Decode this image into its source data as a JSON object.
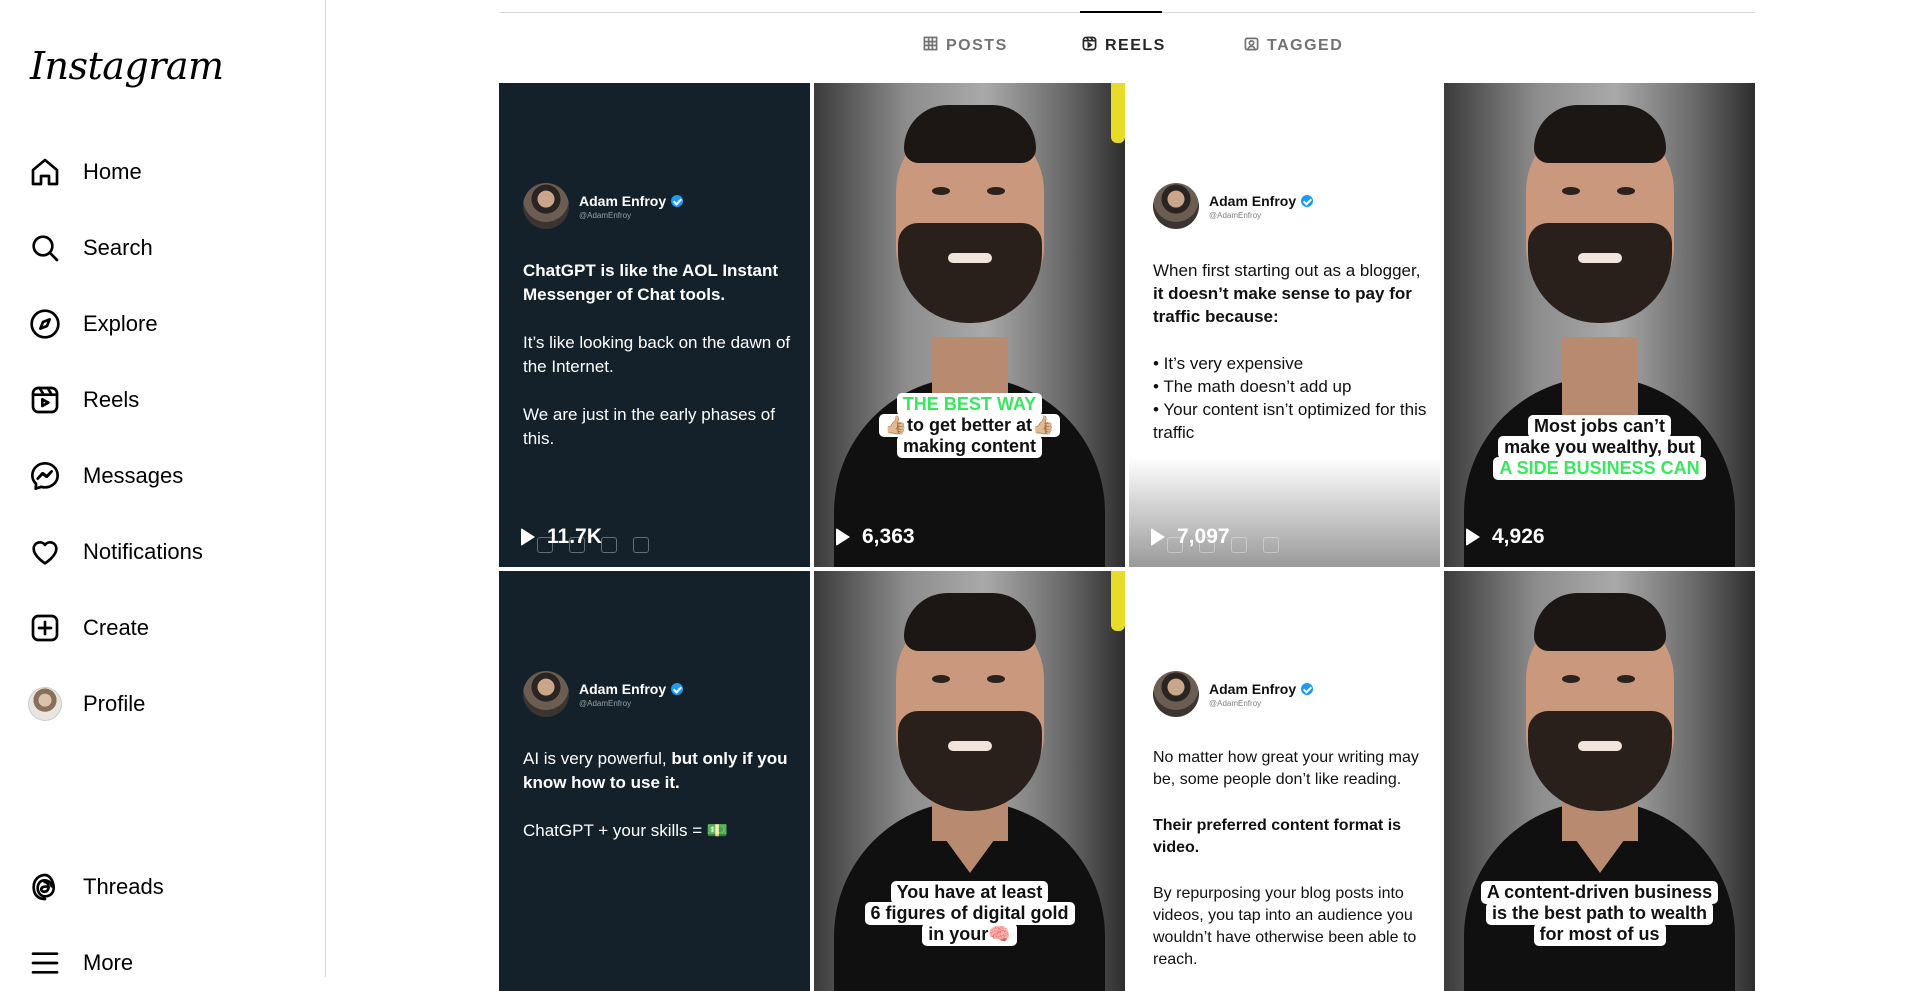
{
  "app": {
    "logo": "Instagram"
  },
  "sidebar": {
    "items": [
      {
        "label": "Home",
        "icon": "home-icon"
      },
      {
        "label": "Search",
        "icon": "search-icon"
      },
      {
        "label": "Explore",
        "icon": "compass-icon"
      },
      {
        "label": "Reels",
        "icon": "reels-icon"
      },
      {
        "label": "Messages",
        "icon": "messenger-icon"
      },
      {
        "label": "Notifications",
        "icon": "heart-icon"
      },
      {
        "label": "Create",
        "icon": "plus-square-icon"
      },
      {
        "label": "Profile",
        "icon": "avatar"
      }
    ],
    "bottom": [
      {
        "label": "Threads",
        "icon": "threads-icon"
      },
      {
        "label": "More",
        "icon": "hamburger-icon"
      }
    ]
  },
  "profile_tabs": [
    {
      "label": "POSTS",
      "icon": "grid-icon",
      "active": false
    },
    {
      "label": "REELS",
      "icon": "reels-icon",
      "active": true
    },
    {
      "label": "TAGGED",
      "icon": "tagged-icon",
      "active": false
    }
  ],
  "reels": [
    {
      "kind": "tweet",
      "theme": "dark",
      "author": "Adam Enfroy",
      "handle": "@AdamEnfroy",
      "paragraphs": [
        "<b>ChatGPT is like the AOL Instant Messenger of Chat tools.</b>",
        "It’s like looking back on the dawn of the Internet.",
        "We are just in the early phases of this."
      ],
      "views": "11.7K"
    },
    {
      "kind": "photo",
      "caption": [
        "THE BEST WAY",
        "👍🏼to get better at👍🏼",
        "making content"
      ],
      "caption_green": [
        0
      ],
      "views": "6,363"
    },
    {
      "kind": "tweet",
      "theme": "light",
      "author": "Adam Enfroy",
      "handle": "@AdamEnfroy",
      "paragraphs": [
        "When first starting out as a blogger, <b>it doesn’t make sense to pay for traffic because:</b>",
        "• It’s very expensive<br>• The math doesn’t add up<br>• Your content isn’t optimized for this traffic"
      ],
      "views": "7,097"
    },
    {
      "kind": "photo",
      "caption": [
        "Most jobs can’t",
        "make you wealthy, but",
        "A SIDE BUSINESS CAN"
      ],
      "caption_green": [
        2
      ],
      "views": "4,926"
    },
    {
      "kind": "tweet",
      "theme": "dark",
      "author": "Adam Enfroy",
      "handle": "@AdamEnfroy",
      "paragraphs": [
        "AI is very powerful, <b>but only if you know how to use it.</b>",
        "ChatGPT + your skills = 💵"
      ],
      "views": ""
    },
    {
      "kind": "photo",
      "caption": [
        "You have at least",
        "6 figures of digital gold",
        "in your🧠"
      ],
      "caption_green": [],
      "views": ""
    },
    {
      "kind": "tweet",
      "theme": "light",
      "author": "Adam Enfroy",
      "handle": "@AdamEnfroy",
      "paragraphs": [
        "No matter how great your writing may be, some people don’t like reading.",
        "<b>Their preferred content format is video.</b>",
        "By repurposing your blog posts into videos, you tap into an audience you wouldn’t have otherwise been able to reach."
      ],
      "views": ""
    },
    {
      "kind": "photo",
      "caption": [
        "A content-driven business",
        "is the best path to wealth",
        "for most of us"
      ],
      "caption_green": [],
      "views": ""
    }
  ],
  "colors": {
    "verified": "#1d9bf0",
    "caption_green": "#39e75f",
    "dark_tile": "#14212b"
  }
}
